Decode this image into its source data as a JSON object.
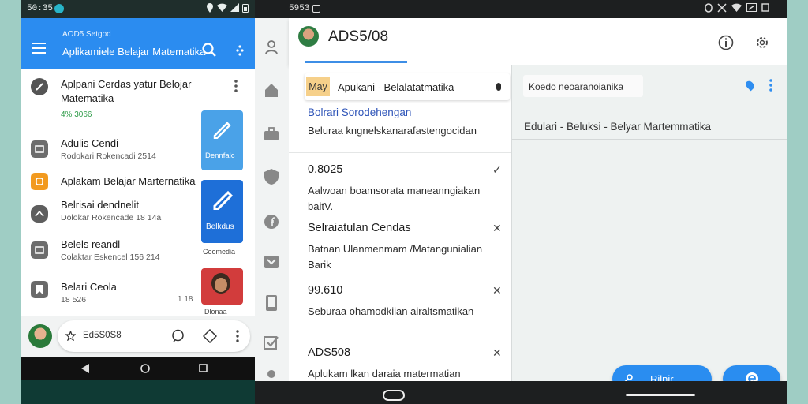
{
  "phone": {
    "status_time": "50:35",
    "appbar": {
      "small_label": "AOD5 Setgod",
      "title": "Aplikamiele Belajar Matematika"
    },
    "list": [
      {
        "title": "Aplpani Cerdas yatur Belojar Matematika",
        "meta": "4% 3066",
        "icon": "lightbulb-icon"
      },
      {
        "title": "Adulis Cendi",
        "sub": "Rodokari Rokencadi 2514",
        "icon": "image-icon"
      },
      {
        "title": "Aplakam Belajar Marternatika",
        "icon": "app-icon"
      },
      {
        "title": "Belrisai dendnelit",
        "sub": "Dolokar Rokencade 18 14a",
        "icon": "chat-icon"
      },
      {
        "title": "Belels reandl",
        "sub": "Colaktar Eskencel 156 214",
        "icon": "image-icon"
      },
      {
        "title": "Belari Ceola",
        "sub": "18 526",
        "meta": "1 18",
        "icon": "bookmark-icon"
      }
    ],
    "side_cards": [
      "Dennfalc",
      "Belkdus",
      "Ceomedia",
      "Dlonaa"
    ],
    "bottom_bar_label": "Ed5S0S8"
  },
  "tablet": {
    "status_time": "5953",
    "header_title": "ADS5/08",
    "chip": {
      "tag": "May",
      "label": "Apukani - Belalatatmatika"
    },
    "list": [
      {
        "title": "Bolrari Sorodehengan",
        "body": "Beluraa kngnelskanarafastengocidan",
        "accent": true
      },
      {
        "title": "0.8025",
        "body": "Aalwoan boamsorata maneanngiakan baitV.",
        "mark": "✓"
      },
      {
        "title": "Selraiatulan Cendas",
        "body": "Batnan Ulanmenmam /Matangunialian Barik",
        "mark": "✕"
      },
      {
        "title": "99.610",
        "body": "Seburaa ohamodkiian airaltsmatikan",
        "mark": "✕"
      },
      {
        "title": "ADS508",
        "body": "Aplukam lkan daraia matermatian",
        "mark": "✕"
      }
    ],
    "detail": {
      "search_text": "Koedo neoaranoianika",
      "breadcrumb": "Edulari - Beluksi - Belyar Martemmatika",
      "fab_label": "Rilnjr"
    },
    "accent_color": "#2b8cf0"
  }
}
